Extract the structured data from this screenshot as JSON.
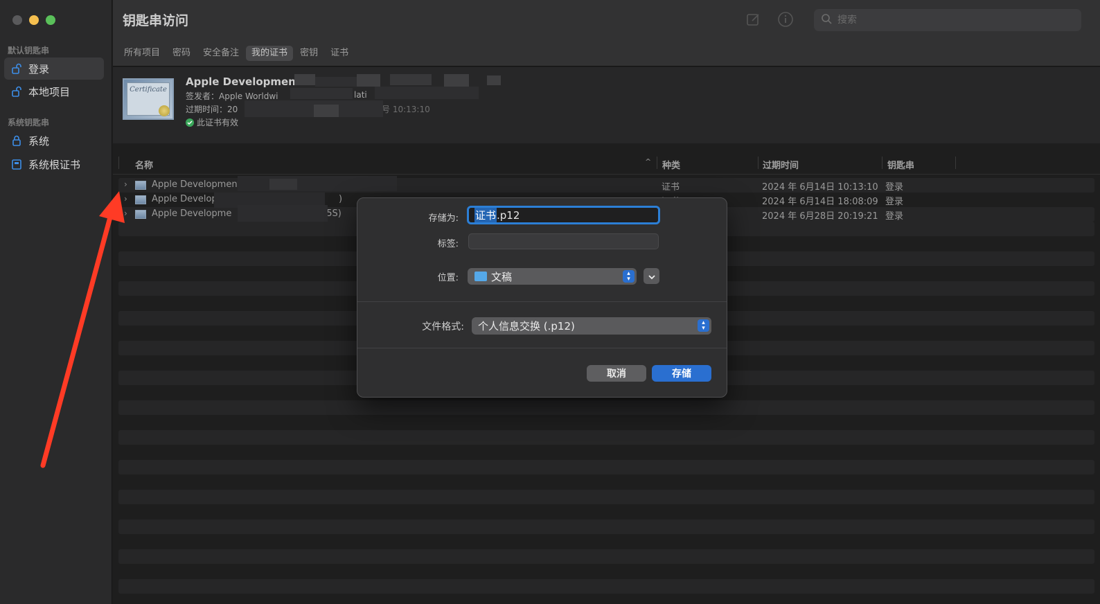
{
  "colors": {
    "accent": "#2a6fd0",
    "arrow": "#ff3b25",
    "close": "#5a5a5c",
    "minimize": "#f5bf4f",
    "zoom": "#5ac05a"
  },
  "window": {
    "title": "钥匙串访问"
  },
  "search": {
    "placeholder": "搜索"
  },
  "sidebar": {
    "default_section": "默认钥匙串",
    "system_section": "系统钥匙串",
    "items": [
      {
        "label": "登录",
        "icon": "unlock-icon",
        "active": true
      },
      {
        "label": "本地项目",
        "icon": "unlock-icon",
        "active": false
      },
      {
        "label": "系统",
        "icon": "lock-icon",
        "active": false
      },
      {
        "label": "系统根证书",
        "icon": "cabinet-icon",
        "active": false
      }
    ]
  },
  "tabs": [
    "所有项目",
    "密码",
    "安全备注",
    "我的证书",
    "密钥",
    "证书"
  ],
  "active_tab": "我的证书",
  "info": {
    "title": "Apple Development:",
    "issuer": "签发者：Apple Worldwi",
    "issuer_tail": "lati",
    "expires": "过期时间：20",
    "expires_tail": "号 10:13:10",
    "valid": "此证书有效",
    "cert_image_text": "Certificate"
  },
  "table": {
    "columns": {
      "name": "名称",
      "kind": "种类",
      "expires": "过期时间",
      "keychain": "钥匙串"
    },
    "rows": [
      {
        "name": "Apple Development",
        "kind": "证书",
        "expires": "2024 年 6月14日 10:13:10",
        "keychain": "登录"
      },
      {
        "name": "Apple Develop",
        "name_tail": ")",
        "kind": "证书",
        "expires": "2024 年 6月14日 18:08:09",
        "keychain": "登录"
      },
      {
        "name": "Apple Developme",
        "name_tail": "95S)",
        "kind": "",
        "expires": "2024 年 6月28日 20:19:21",
        "keychain": "登录"
      }
    ]
  },
  "dialog": {
    "save_as_label": "存储为:",
    "save_as_selected": "证书",
    "save_as_rest": ".p12",
    "tags_label": "标签:",
    "location_label": "位置:",
    "location_value": "文稿",
    "format_label": "文件格式:",
    "format_value": "个人信息交换 (.p12)",
    "cancel": "取消",
    "save": "存储"
  }
}
